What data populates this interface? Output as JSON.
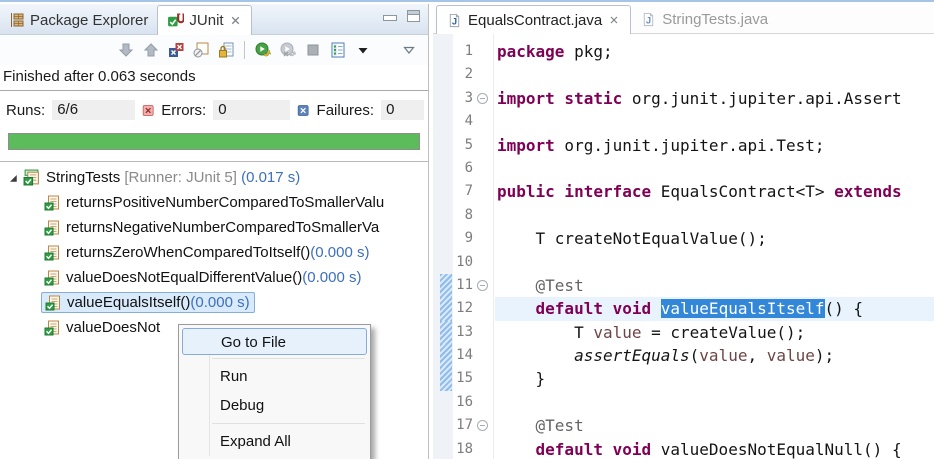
{
  "colors": {
    "progress_green": "#5CBC5C",
    "selection_blue": "#3287D9",
    "keyword_maroon": "#7F0055",
    "time_blue": "#3D6FBE",
    "annotation_gray": "#646464",
    "tree_select_bg": "#D9EAFB"
  },
  "junit_view": {
    "tabs": [
      {
        "label": "Package Explorer",
        "active": false
      },
      {
        "label": "JUnit",
        "active": true
      }
    ],
    "toolbar": [
      {
        "name": "show-next-failed-test",
        "icon": "arrow-down-icon"
      },
      {
        "name": "show-previous-failed-test",
        "icon": "arrow-up-icon"
      },
      {
        "name": "show-failures-only",
        "icon": "failures-only-icon"
      },
      {
        "name": "show-skipped-tests-only",
        "icon": "skipped-tests-icon"
      },
      {
        "name": "scroll-lock",
        "icon": "scroll-lock-icon"
      },
      {
        "type": "separator"
      },
      {
        "name": "rerun-test",
        "icon": "rerun-test-icon"
      },
      {
        "name": "rerun-failed-tests",
        "icon": "rerun-failed-icon"
      },
      {
        "name": "stop-junit-test-run",
        "icon": "stop-icon"
      },
      {
        "name": "test-run-history",
        "icon": "history-icon"
      },
      {
        "name": "history-dropdown",
        "icon": "caret-down-icon"
      },
      {
        "type": "gap"
      },
      {
        "name": "view-menu",
        "icon": "view-menu-icon"
      }
    ],
    "status_text": "Finished after 0.063 seconds",
    "counters": {
      "runs_label": "Runs:",
      "runs_value": "6/6",
      "errors_label": "Errors:",
      "errors_value": "0",
      "failures_label": "Failures:",
      "failures_value": "0"
    },
    "progress": {
      "percent": 100
    },
    "tree": {
      "root": {
        "label": "StringTests",
        "runner": " [Runner: JUnit 5]",
        "time": " (0.017 s)",
        "expanded": true
      },
      "items": [
        {
          "label": "returnsPositiveNumberComparedToSmallerValu",
          "time": ""
        },
        {
          "label": "returnsNegativeNumberComparedToSmallerVa",
          "time": ""
        },
        {
          "label": "returnsZeroWhenComparedToItself()",
          "time": " (0.000 s)"
        },
        {
          "label": "valueDoesNotEqualDifferentValue()",
          "time": " (0.000 s)"
        },
        {
          "label": "valueEqualsItself()",
          "time": " (0.000 s)",
          "selected": true
        },
        {
          "label": "valueDoesNot",
          "time": ""
        }
      ]
    }
  },
  "context_menu": {
    "items": [
      {
        "label": "Go to File",
        "highlighted": true
      },
      {
        "type": "separator"
      },
      {
        "label": "Run"
      },
      {
        "label": "Debug"
      },
      {
        "type": "separator"
      },
      {
        "label": "Expand All"
      }
    ]
  },
  "editor": {
    "tabs": [
      {
        "label": "EqualsContract.java",
        "active": true,
        "closable": true
      },
      {
        "label": "StringTests.java",
        "active": false
      }
    ],
    "code": {
      "lines": [
        {
          "n": 1,
          "segs": [
            [
              "kw",
              "package"
            ],
            [
              "pl",
              " pkg;"
            ]
          ]
        },
        {
          "n": 2,
          "segs": []
        },
        {
          "n": 3,
          "fold": true,
          "segs": [
            [
              "kw",
              "import static"
            ],
            [
              "pl",
              " org.junit.jupiter.api.Assert"
            ]
          ]
        },
        {
          "n": 4,
          "segs": []
        },
        {
          "n": 5,
          "segs": [
            [
              "kw",
              "import"
            ],
            [
              "pl",
              " org.junit.jupiter.api.Test;"
            ]
          ]
        },
        {
          "n": 6,
          "segs": []
        },
        {
          "n": 7,
          "segs": [
            [
              "kw",
              "public interface"
            ],
            [
              "pl",
              " EqualsContract<T> "
            ],
            [
              "kw",
              "extends"
            ]
          ]
        },
        {
          "n": 8,
          "segs": []
        },
        {
          "n": 9,
          "segs": [
            [
              "pl",
              "    T createNotEqualValue();"
            ]
          ]
        },
        {
          "n": 10,
          "segs": []
        },
        {
          "n": 11,
          "fold": true,
          "range": true,
          "segs": [
            [
              "ann",
              "    @Test"
            ]
          ]
        },
        {
          "n": 12,
          "range": true,
          "cur": true,
          "segs": [
            [
              "pl",
              "    "
            ],
            [
              "kw",
              "default void"
            ],
            [
              "pl",
              " "
            ],
            [
              "sel",
              "valueEqualsItself"
            ],
            [
              "pl",
              "() {"
            ]
          ]
        },
        {
          "n": 13,
          "range": true,
          "segs": [
            [
              "pl",
              "        T "
            ],
            [
              "var",
              "value"
            ],
            [
              "pl",
              " = createValue();"
            ]
          ]
        },
        {
          "n": 14,
          "range": true,
          "segs": [
            [
              "pl",
              "        "
            ],
            [
              "stat",
              "assertEquals"
            ],
            [
              "pl",
              "("
            ],
            [
              "var",
              "value"
            ],
            [
              "pl",
              ", "
            ],
            [
              "var",
              "value"
            ],
            [
              "pl",
              ");"
            ]
          ]
        },
        {
          "n": 15,
          "range": true,
          "segs": [
            [
              "pl",
              "    }"
            ]
          ]
        },
        {
          "n": 16,
          "segs": []
        },
        {
          "n": 17,
          "fold": true,
          "segs": [
            [
              "ann",
              "    @Test"
            ]
          ]
        },
        {
          "n": 18,
          "segs": [
            [
              "pl",
              "    "
            ],
            [
              "kw",
              "default void"
            ],
            [
              "pl",
              " valueDoesNotEqualNull() {"
            ]
          ]
        }
      ]
    }
  }
}
